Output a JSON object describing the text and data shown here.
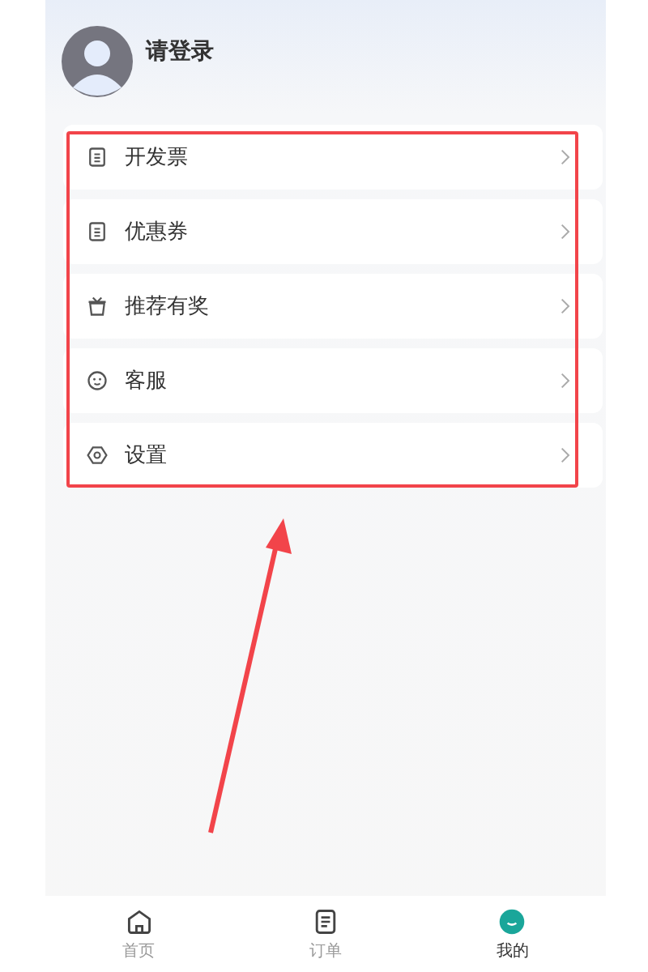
{
  "profile": {
    "login_prompt": "请登录"
  },
  "menu": [
    {
      "kind": "document",
      "label": "开发票"
    },
    {
      "kind": "document",
      "label": "优惠券"
    },
    {
      "kind": "gift",
      "label": "推荐有奖"
    },
    {
      "kind": "smile",
      "label": "客服"
    },
    {
      "kind": "settings",
      "label": "设置"
    }
  ],
  "tab_bar": [
    {
      "kind": "home",
      "label": "首页",
      "selected": false
    },
    {
      "kind": "orders",
      "label": "订单",
      "selected": false
    },
    {
      "kind": "me",
      "label": "我的",
      "selected": true
    }
  ]
}
